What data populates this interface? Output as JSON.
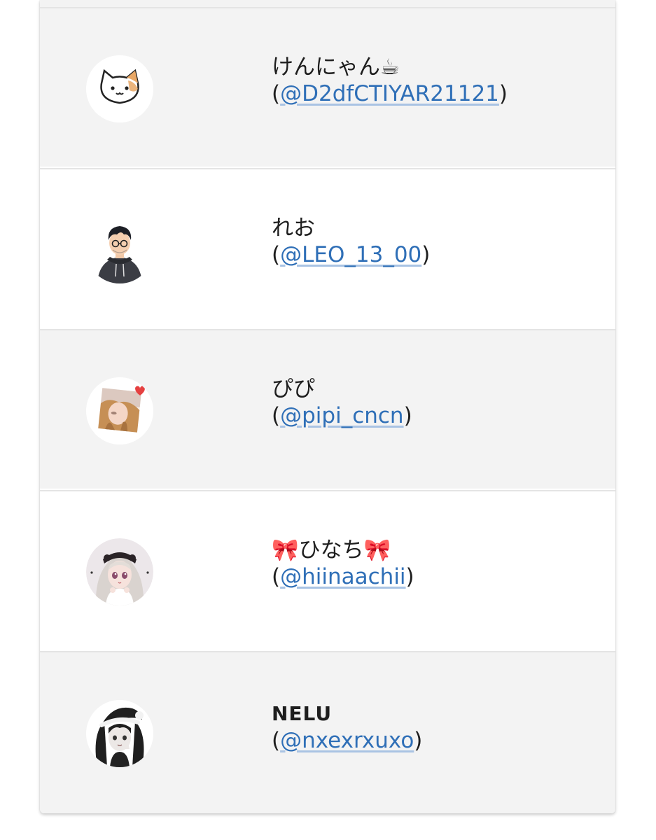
{
  "users": [
    {
      "name": "けんにゃん☕",
      "handle": "@D2dfCTIYAR21121",
      "avatar": "cat-avatar"
    },
    {
      "name": "れお",
      "handle": "@LEO_13_00",
      "avatar": "hoodie-man-avatar"
    },
    {
      "name": "ぴぴ",
      "handle": "@pipi_cncn",
      "avatar": "photo-girl-avatar"
    },
    {
      "name": "🎀ひなち🎀",
      "handle": "@hiinaachii",
      "avatar": "anime-girl-avatar"
    },
    {
      "name": "NELU",
      "handle": "@nxexrxuxo",
      "avatar": "santa-hat-girl-avatar"
    }
  ],
  "colors": {
    "row_gray": "#f3f3f3",
    "row_white": "#ffffff",
    "link": "#2f6fb7",
    "divider": "#e4e4e4"
  },
  "punct": {
    "open": "(",
    "close": ")"
  }
}
